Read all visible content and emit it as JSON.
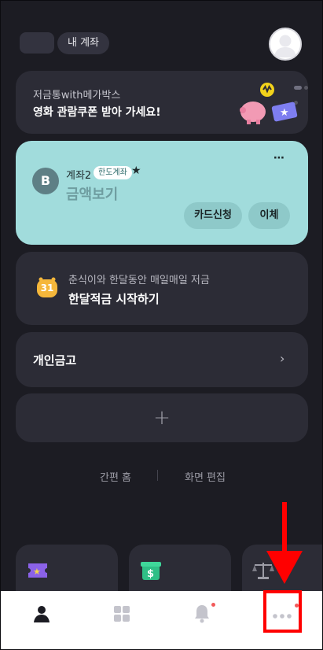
{
  "header": {
    "account_chip": "내 계좌"
  },
  "promo": {
    "subtitle": "저금통with메가박스",
    "title": "영화 관람쿠폰 받아 가세요!"
  },
  "main_account": {
    "name": "계좌2",
    "badge": "한도계좌",
    "balance_label": "금액보기",
    "bank_initial": "B",
    "buttons": {
      "card_apply": "카드신청",
      "transfer": "이체"
    },
    "color": "#a1dcdc"
  },
  "savings": {
    "subtitle": "춘식이와 한달동안 매일매일 저금",
    "title": "한달적금 시작하기",
    "calendar_day": "31"
  },
  "safebox": {
    "title": "개인금고"
  },
  "add_card": {
    "symbol": "+"
  },
  "footer_links": {
    "simple_home": "간편 홈",
    "edit_screen": "화면 편집"
  },
  "bottom_nav": {
    "items": [
      {
        "icon": "person-icon"
      },
      {
        "icon": "grid-icon"
      },
      {
        "icon": "bell-icon",
        "has_badge": true
      },
      {
        "icon": "more-icon",
        "has_badge": true
      }
    ]
  },
  "colors": {
    "background": "#1c1c23",
    "card": "#2c2c36",
    "highlight": "#ff0000",
    "badge": "#f25a5a"
  }
}
